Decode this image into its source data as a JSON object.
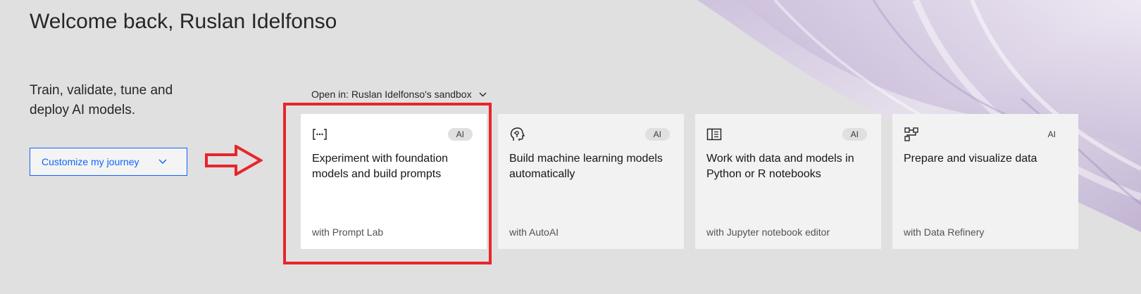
{
  "colors": {
    "accent": "#0f62fe",
    "highlight": "#e8252b",
    "background": "#e0e0e0"
  },
  "header": {
    "title": "Welcome back, Ruslan Idelfonso"
  },
  "intro": {
    "tagline": "Train, validate, tune and deploy AI models.",
    "customize_label": "Customize my journey"
  },
  "open_in": {
    "label": "Open in: Ruslan Idelfonso's sandbox"
  },
  "cards": [
    {
      "icon": "prompt-brackets-icon",
      "tag": "AI",
      "title": "Experiment with foundation models and build prompts",
      "subtitle": "with Prompt Lab"
    },
    {
      "icon": "machine-learning-head-icon",
      "tag": "AI",
      "title": "Build machine learning models automatically",
      "subtitle": "with AutoAI"
    },
    {
      "icon": "notebook-icon",
      "tag": "AI",
      "title": "Work with data and models in Python or R notebooks",
      "subtitle": "with Jupyter notebook editor"
    },
    {
      "icon": "data-refinery-icon",
      "tag": "AI",
      "title": "Prepare and visualize data",
      "subtitle": "with Data Refinery"
    }
  ]
}
